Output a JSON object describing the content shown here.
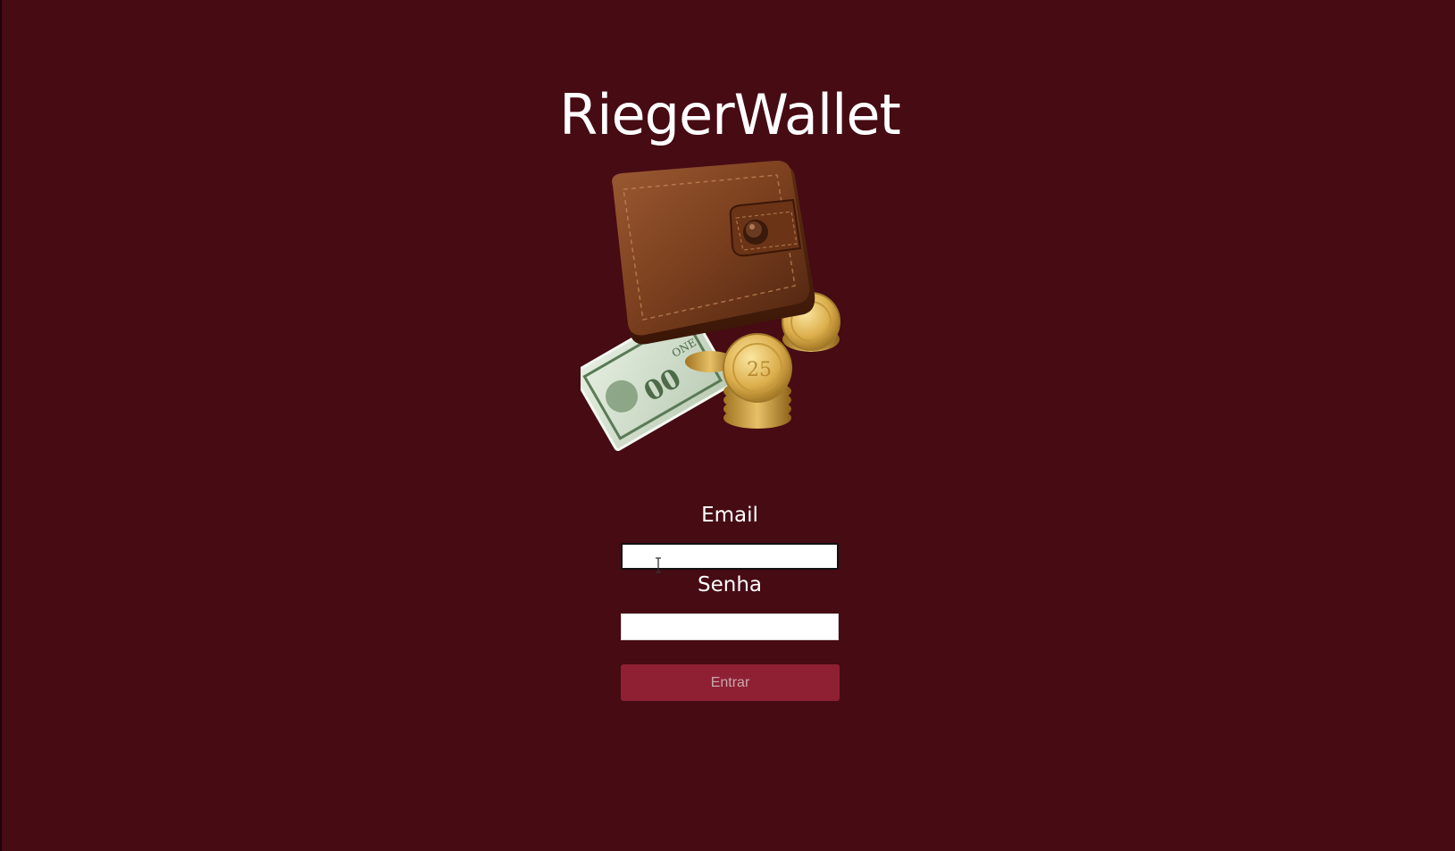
{
  "app": {
    "title": "RiegerWallet"
  },
  "illustration": {
    "icon": "wallet-with-money-and-coins-icon",
    "coin_label": "25",
    "bill_label": "ONE"
  },
  "login_form": {
    "email_label": "Email",
    "email_value": "",
    "password_label": "Senha",
    "password_value": "",
    "submit_label": "Entrar"
  },
  "colors": {
    "background": "#460b13",
    "button": "#8f2033",
    "button_text": "#c9a8ae",
    "title_text": "#ffffff"
  }
}
